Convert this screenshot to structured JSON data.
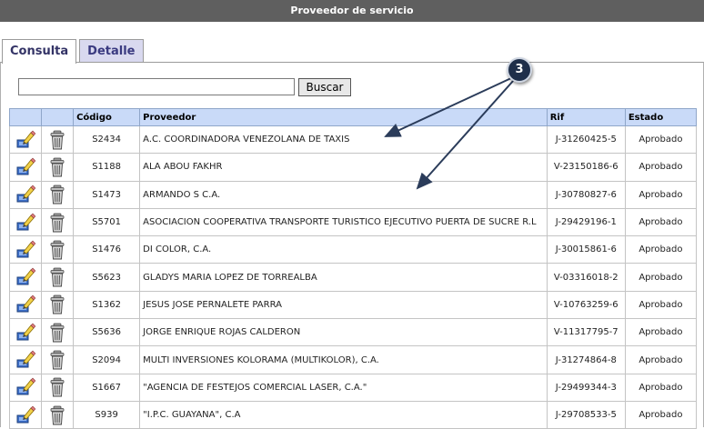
{
  "window": {
    "title": "Proveedor de servicio"
  },
  "tabs": [
    {
      "label": "Consulta",
      "active": true
    },
    {
      "label": "Detalle",
      "active": false
    }
  ],
  "search": {
    "value": "",
    "button_label": "Buscar"
  },
  "callout": {
    "number": "3"
  },
  "table": {
    "headers": {
      "codigo": "Código",
      "proveedor": "Proveedor",
      "rif": "Rif",
      "estado": "Estado"
    },
    "rows": [
      {
        "codigo": "S2434",
        "proveedor": "A.C. COORDINADORA VENEZOLANA DE TAXIS",
        "rif": "J-31260425-5",
        "estado": "Aprobado"
      },
      {
        "codigo": "S1188",
        "proveedor": "ALA ABOU FAKHR",
        "rif": "V-23150186-6",
        "estado": "Aprobado"
      },
      {
        "codigo": "S1473",
        "proveedor": "ARMANDO S C.A.",
        "rif": "J-30780827-6",
        "estado": "Aprobado"
      },
      {
        "codigo": "S5701",
        "proveedor": "ASOCIACION COOPERATIVA TRANSPORTE TURISTICO EJECUTIVO PUERTA DE SUCRE R.L",
        "rif": "J-29429196-1",
        "estado": "Aprobado"
      },
      {
        "codigo": "S1476",
        "proveedor": "DI COLOR, C.A.",
        "rif": "J-30015861-6",
        "estado": "Aprobado"
      },
      {
        "codigo": "S5623",
        "proveedor": "GLADYS MARIA LOPEZ DE TORREALBA",
        "rif": "V-03316018-2",
        "estado": "Aprobado"
      },
      {
        "codigo": "S1362",
        "proveedor": "JESUS JOSE PERNALETE PARRA",
        "rif": "V-10763259-6",
        "estado": "Aprobado"
      },
      {
        "codigo": "S5636",
        "proveedor": "JORGE ENRIQUE ROJAS CALDERON",
        "rif": "V-11317795-7",
        "estado": "Aprobado"
      },
      {
        "codigo": "S2094",
        "proveedor": "MULTI INVERSIONES KOLORAMA (MULTIKOLOR), C.A.",
        "rif": "J-31274864-8",
        "estado": "Aprobado"
      },
      {
        "codigo": "S1667",
        "proveedor": "\"AGENCIA DE FESTEJOS COMERCIAL LASER, C.A.\"",
        "rif": "J-29499344-3",
        "estado": "Aprobado"
      },
      {
        "codigo": "S939",
        "proveedor": "\"I.P.C. GUAYANA\", C.A",
        "rif": "J-29708533-5",
        "estado": "Aprobado"
      }
    ]
  },
  "icons": {
    "edit": "edit-pencil-icon",
    "delete": "trash-can-icon"
  },
  "colors": {
    "titlebar": "#5f5f5f",
    "header_row": "#c9daf8",
    "tab_active_text": "#333366",
    "callout_fill": "#1f2f4a"
  }
}
